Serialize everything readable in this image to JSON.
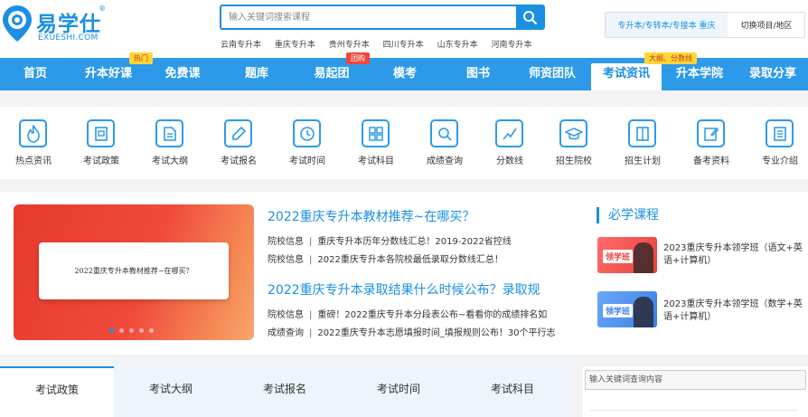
{
  "header": {
    "logo_name": "易学仕",
    "logo_reg": "®",
    "logo_domain": "EXUESHI.COM",
    "search_placeholder": "输入关键词搜索课程",
    "hot_links": [
      "云南专升本",
      "重庆专升本",
      "贵州专升本",
      "四川专升本",
      "山东专升本",
      "河南专升本"
    ],
    "region_current": "专升本/专转本/专接本 重庆",
    "region_switch": "切换项目/地区"
  },
  "nav": {
    "items": [
      "首页",
      "升本好课",
      "免费课",
      "题库",
      "易起团",
      "模考",
      "图书",
      "师资团队",
      "考试资讯",
      "升本学院",
      "录取分享"
    ],
    "active_index": 8,
    "badges": {
      "hot": "热门",
      "group": "团购",
      "outline": "大纲、分数线"
    }
  },
  "quick_icons": [
    "热点资讯",
    "考试政策",
    "考试大纲",
    "考试报名",
    "考试时间",
    "考试科目",
    "成绩查询",
    "分数线",
    "招生院校",
    "招生计划",
    "备考资料",
    "专业介绍"
  ],
  "banner": {
    "card_text": "2022重庆专升本教材推荐~在哪买？",
    "dot_count": 5,
    "active_dot": 0
  },
  "news": {
    "block1_title": "2022重庆专升本教材推荐~在哪买？",
    "block1_lines": [
      {
        "cat": "院校信息",
        "text": "重庆专升本历年分数线汇总！2019-2022省控线"
      },
      {
        "cat": "院校信息",
        "text": "2022重庆专升本各院校最低录取分数线汇总！"
      }
    ],
    "block2_title": "2022重庆专升本录取结果什么时候公布？录取规",
    "block2_lines": [
      {
        "cat": "院校信息",
        "text": "重磅！2022重庆专升本分段表公布~看看你的成绩排名如"
      },
      {
        "cat": "成绩查询",
        "text": "2022重庆专升本志愿填报时间_填报规则公布！30个平行志"
      }
    ]
  },
  "courses": {
    "title": "必学课程",
    "thumb_label": "领学班",
    "items": [
      {
        "name": "2023重庆专升本领学班（语文+英语+计算机）"
      },
      {
        "name": "2023重庆专升本领学班（数学+英语+计算机）"
      }
    ]
  },
  "tabs": {
    "items": [
      "考试政策",
      "考试大纲",
      "考试报名",
      "考试时间",
      "考试科目"
    ],
    "active_index": 0
  },
  "side_search": {
    "placeholder": "输入关键词查询内容"
  },
  "colors": {
    "brand_blue": "#1a8fe3",
    "nav_blue": "#2c9ae8",
    "badge_yellow": "#ffd633",
    "badge_red": "#f0453a"
  }
}
